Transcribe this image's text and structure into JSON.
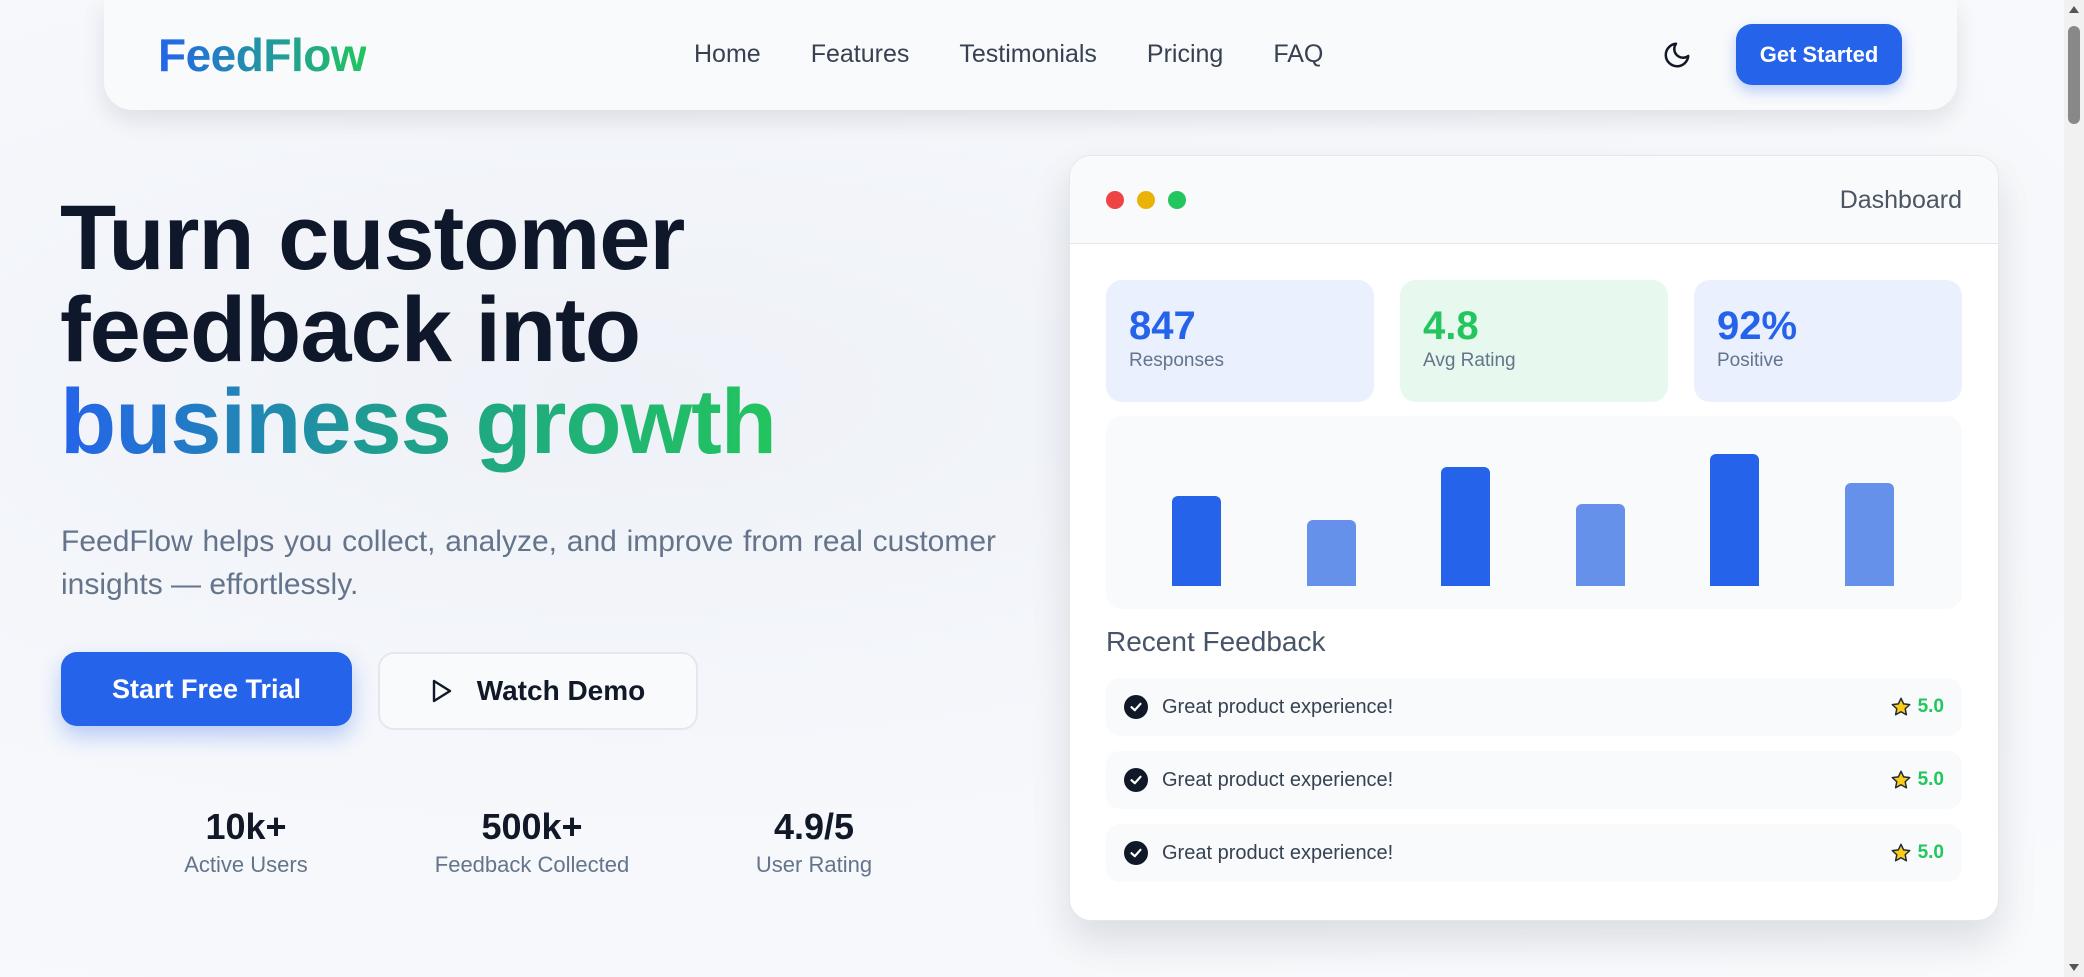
{
  "navbar": {
    "logo": "FeedFlow",
    "links": [
      "Home",
      "Features",
      "Testimonials",
      "Pricing",
      "FAQ"
    ],
    "theme_icon": "moon-icon",
    "cta": "Get Started"
  },
  "hero": {
    "title_line1": "Turn customer",
    "title_line2": "feedback into",
    "title_gradient": "business growth",
    "subtitle": "FeedFlow helps you collect, analyze, and improve from real customer insights — effortlessly.",
    "primary_button": "Start Free Trial",
    "secondary_button": "Watch Demo",
    "stats": [
      {
        "value": "10k+",
        "label": "Active Users"
      },
      {
        "value": "500k+",
        "label": "Feedback Collected"
      },
      {
        "value": "4.9/5",
        "label": "User Rating"
      }
    ]
  },
  "dashboard": {
    "title": "Dashboard",
    "window_dots": [
      "#ef4444",
      "#eab308",
      "#22c55e"
    ],
    "kpis": [
      {
        "value": "847",
        "label": "Responses",
        "color": "#2563eb",
        "bg": "#eaf0fd"
      },
      {
        "value": "4.8",
        "label": "Avg Rating",
        "color": "#22c55e",
        "bg": "#e7f8ee"
      },
      {
        "value": "92%",
        "label": "Positive",
        "color": "#2563eb",
        "bg": "#eaf0fd"
      }
    ],
    "recent_title": "Recent Feedback",
    "feedback": [
      {
        "text": "Great product experience!",
        "rating": "5.0"
      },
      {
        "text": "Great product experience!",
        "rating": "5.0"
      },
      {
        "text": "Great product experience!",
        "rating": "5.0"
      }
    ]
  },
  "chart_data": {
    "type": "bar",
    "values": [
      68,
      50,
      90,
      62,
      100,
      78
    ],
    "ylim": [
      0,
      100
    ],
    "colors": [
      "#2563eb",
      "#6591ea",
      "#2563eb",
      "#6591ea",
      "#2563eb",
      "#6591ea"
    ]
  },
  "colors": {
    "primary": "#2563eb",
    "accent_green": "#22c55e",
    "text_dark": "#0f172a",
    "text_muted": "#64748b"
  }
}
